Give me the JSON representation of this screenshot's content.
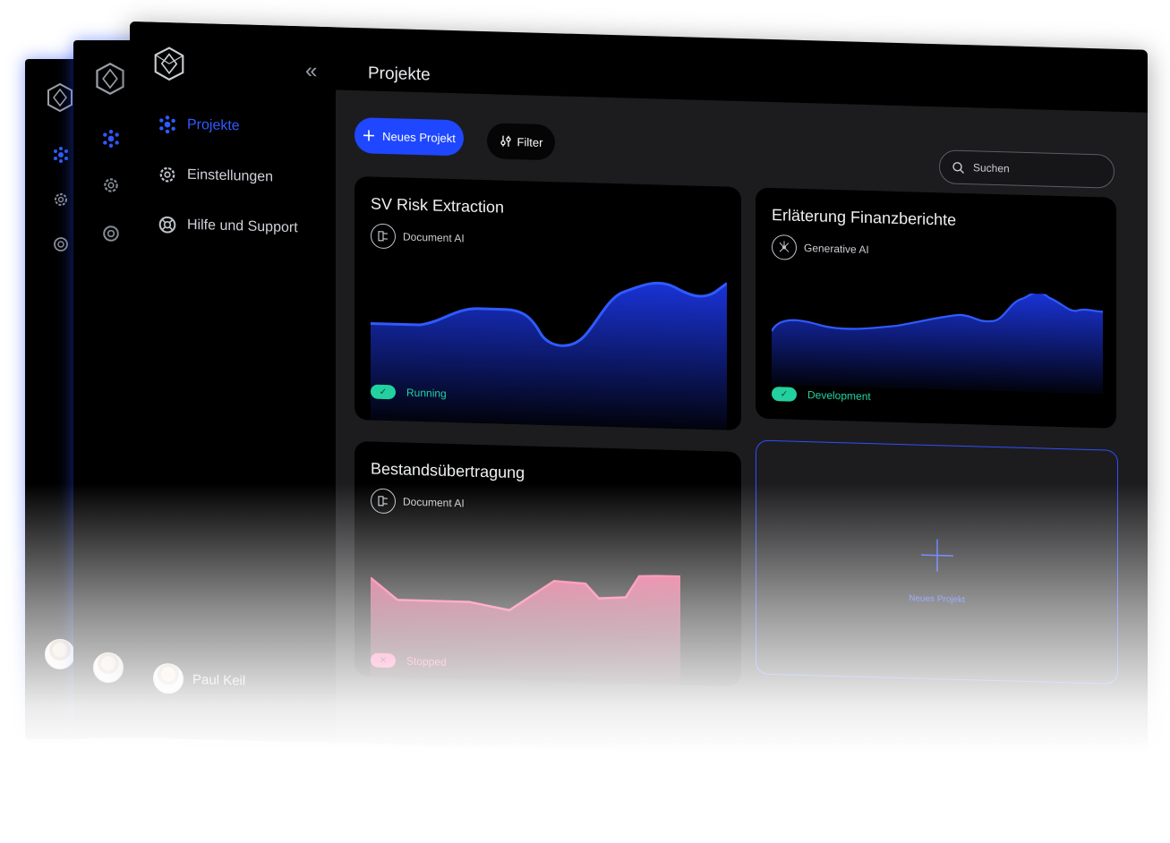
{
  "header": {
    "title": "Projekte"
  },
  "sidebar": {
    "collapse_icon": "double-chevron-left-icon",
    "items": [
      {
        "label": "Projekte",
        "icon": "cluster-icon",
        "active": true
      },
      {
        "label": "Einstellungen",
        "icon": "gear-icon",
        "active": false
      },
      {
        "label": "Hilfe und Support",
        "icon": "lifebuoy-icon",
        "active": false
      }
    ],
    "user": {
      "name": "Paul Keil"
    }
  },
  "toolbar": {
    "new_label": "Neues Projekt",
    "filter_label": "Filter",
    "search_placeholder": "Suchen"
  },
  "projects": [
    {
      "title": "SV Risk Extraction",
      "type": "Document AI",
      "status": "Running",
      "status_color": "#23d0a0",
      "chart_color": "#1e3cff"
    },
    {
      "title": "Erläterung Finanzberichte",
      "type": "Generative AI",
      "status": "Development",
      "status_color": "#23d0a0",
      "chart_color": "#1e3cff"
    },
    {
      "title": "Bestandsübertragung",
      "type": "Document AI",
      "status": "Stopped",
      "status_color": "#ff4f9a",
      "chart_color": "#ff5a8f"
    }
  ],
  "add_card": {
    "label": "Neues Projekt"
  },
  "colors": {
    "accent": "#1e47ff",
    "background": "#1c1c1e",
    "running": "#23d0a0",
    "stopped": "#ff4f9a"
  }
}
